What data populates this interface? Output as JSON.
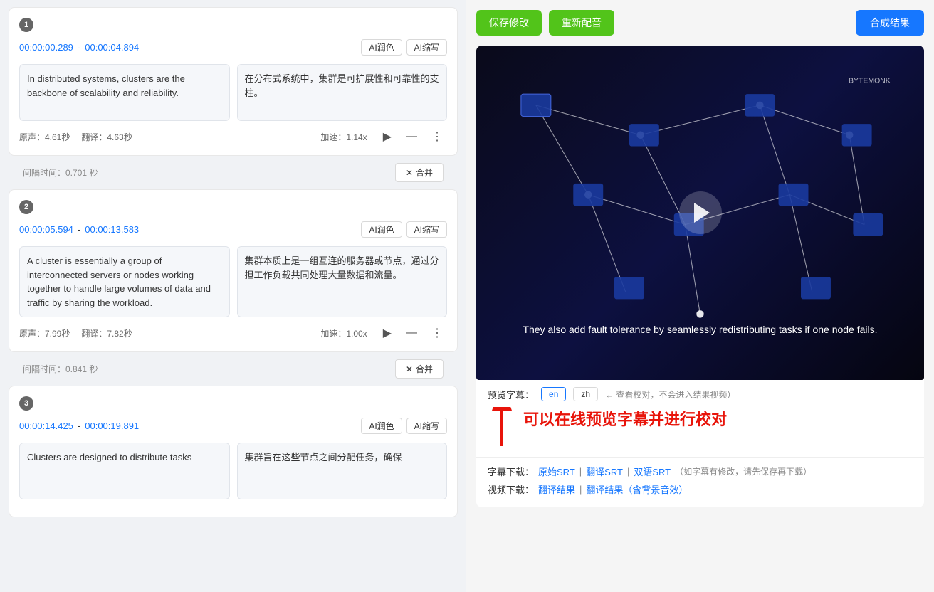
{
  "left": {
    "segments": [
      {
        "id": 1,
        "time_start": "00:00:00.289",
        "time_end": "00:00:04.894",
        "original_text": "In distributed systems, clusters are the backbone of scalability and reliability.",
        "translated_text": "在分布式系统中，集群是可扩展性和可靠性的支柱。",
        "duration_original": "原声：4.61秒",
        "duration_translated": "翻译：4.63秒",
        "speed": "加速：1.14x"
      },
      {
        "id": 2,
        "time_start": "00:00:05.594",
        "time_end": "00:00:13.583",
        "original_text": "A cluster is essentially a group of interconnected servers or nodes working together to handle large volumes of data and traffic by sharing the workload.",
        "translated_text": "集群本质上是一组互连的服务器或节点，通过分担工作负载共同处理大量数据和流量。",
        "duration_original": "原声：7.99秒",
        "duration_translated": "翻译：7.82秒",
        "speed": "加速：1.00x"
      },
      {
        "id": 3,
        "time_start": "00:00:14.425",
        "time_end": "00:00:19.891",
        "original_text": "Clusters are designed to distribute tasks",
        "translated_text": "集群旨在这些节点之间分配任务，确保",
        "duration_original": "",
        "duration_translated": "",
        "speed": ""
      }
    ],
    "gaps": [
      {
        "label": "间隔时间：0.701 秒",
        "merge_label": "合并"
      },
      {
        "label": "间隔时间：0.841 秒",
        "merge_label": "合并"
      }
    ],
    "ai_btn1": "AI润色",
    "ai_btn2": "AI缩写"
  },
  "right": {
    "btn_save": "保存修改",
    "btn_reconfig": "重新配音",
    "btn_compose": "合成结果",
    "video_subtitle": "They also add fault tolerance by seamlessly redistributing tasks if one node fails.",
    "preview_label": "预览字幕：",
    "lang_en": "en",
    "lang_zh": "zh",
    "preview_note": "仅查看校对，不会进入结果视频）",
    "big_text": "可以在线预览字幕并进行校对",
    "subtitle_download_label": "字幕下载：",
    "subtitle_original": "原始SRT",
    "subtitle_translated": "翻译SRT",
    "subtitle_bilingual": "双语SRT",
    "subtitle_note": "（如字幕有修改，请先保存再下载）",
    "video_download_label": "视频下载：",
    "video_translated": "翻译结果",
    "video_with_bgm": "翻译结果（含背景音效）"
  }
}
